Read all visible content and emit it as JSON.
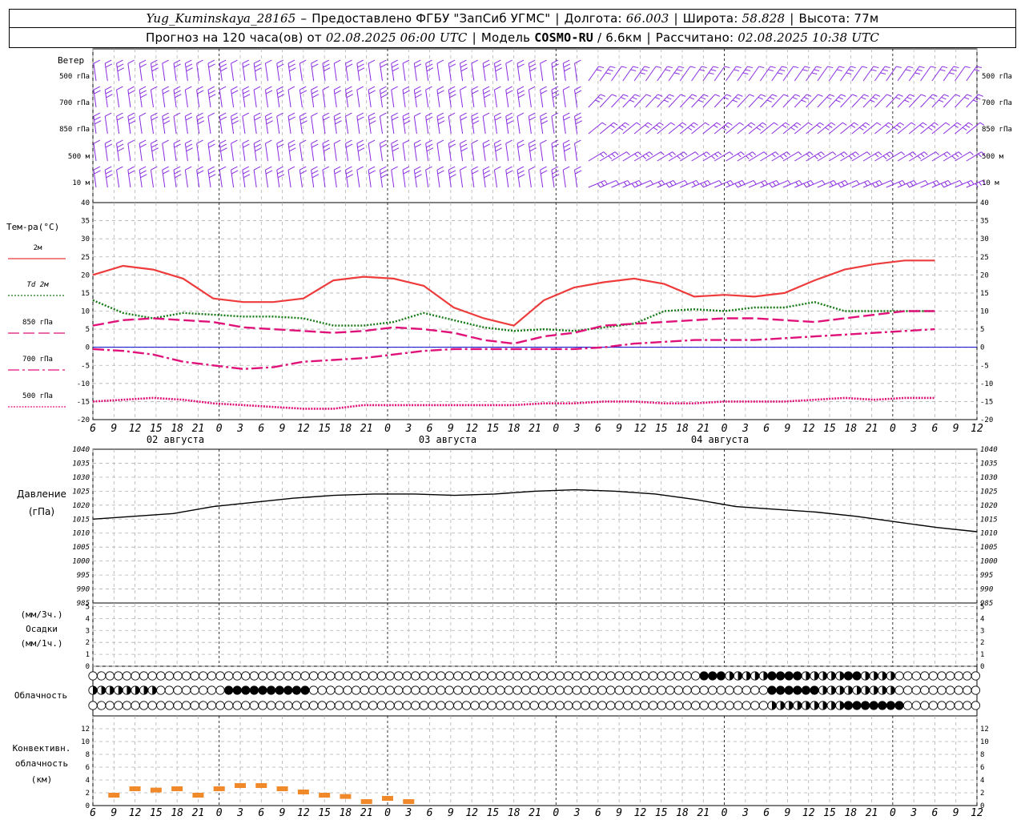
{
  "header": {
    "station": "Yug_Kuminskaya_28165",
    "dash": "–",
    "provider": "Предоставлено ФГБУ \"ЗапСиб УГМС\"",
    "lon_label": "Долгота:",
    "lon_value": "66.003",
    "lat_label": "Широта:",
    "lat_value": "58.828",
    "alt_label": "Высота:",
    "alt_value": "77м",
    "forecast_prefix": "Прогноз на 120 часа(ов) от",
    "forecast_start": "02.08.2025 06:00 UTC",
    "model_label": "Модель",
    "model_name": "COSMO-RU",
    "model_res": "/ 6.6км",
    "calc_label": "Рассчитано:",
    "calc_time": "02.08.2025 10:38 UTC"
  },
  "colors": {
    "t2m": "#ee3b3b",
    "td2m": "#157a15",
    "t850": "#e0127a",
    "t700": "#e0127a",
    "t500": "#e0127a",
    "wind": "#8a2be2",
    "pressure": "#000000",
    "convective": "#f0892a",
    "zero_line": "#0000cc",
    "grid": "#b0b0b0",
    "cloud_full": "#000000"
  },
  "wind_panel": {
    "title": "Ветер",
    "levels": [
      "500 гПа",
      "700 гПа",
      "850 гПа",
      "500 м",
      "10 м"
    ]
  },
  "temp_panel": {
    "title": "Тем-ра(°C)",
    "legend": [
      {
        "label": "2м",
        "style": "solid"
      },
      {
        "label": "Td 2м",
        "style": "dotted"
      },
      {
        "label": "850 гПа",
        "style": "dash"
      },
      {
        "label": "700 гПа",
        "style": "dashdot"
      },
      {
        "label": "500 гПа",
        "style": "dense-dot"
      }
    ]
  },
  "pressure_panel": {
    "title_1": "Давление",
    "title_2": "(гПа)"
  },
  "precip_panel": {
    "title_1": "(мм/3ч.)",
    "title_2": "Осадки",
    "title_3": "(мм/1ч.)"
  },
  "cloud_panel": {
    "title": "Облачность"
  },
  "conv_panel": {
    "title_1": "Конвективн.",
    "title_2": "облачность",
    "title_3": "(км)"
  },
  "date_labels": [
    "02 августа",
    "03 августа",
    "04 августа"
  ],
  "chart_data": [
    {
      "type": "line",
      "name": "temperature",
      "x_hours": [
        0,
        3,
        6,
        9,
        12,
        15,
        18,
        21,
        24,
        27,
        30,
        33,
        36,
        39,
        42,
        45,
        48,
        51,
        54,
        57,
        60,
        63,
        66,
        69,
        72,
        75,
        78,
        81,
        84,
        87,
        90,
        93,
        96,
        99,
        102,
        105,
        108,
        111,
        114,
        117,
        120
      ],
      "ylim": [
        -20,
        40
      ],
      "yticks": [
        -20,
        -15,
        -10,
        -5,
        0,
        5,
        10,
        15,
        20,
        25,
        30,
        35,
        40
      ],
      "xtick_labels": [
        "6",
        "9",
        "12",
        "15",
        "18",
        "21",
        "0",
        "3",
        "6",
        "9",
        "12",
        "15",
        "18",
        "21",
        "0",
        "3",
        "6",
        "9",
        "12",
        "15",
        "18",
        "21",
        "0",
        "3",
        "6",
        "9",
        "12",
        "15",
        "18",
        "21",
        "0",
        "3",
        "6",
        "9",
        "12",
        "15",
        "18",
        "21",
        "0",
        "3",
        "6",
        "9",
        "12"
      ],
      "series": [
        {
          "name": "2м",
          "values": [
            20,
            22.5,
            21.5,
            19,
            13.5,
            12.5,
            12.5,
            13.5,
            18.5,
            19.5,
            19,
            17,
            11,
            8,
            6,
            13,
            16.5,
            18,
            19,
            17.5,
            14,
            14.5,
            14,
            15,
            18.5,
            21.5,
            23,
            24,
            24
          ]
        },
        {
          "name": "Td 2м",
          "values": [
            13,
            9.5,
            8,
            9.5,
            9,
            8.5,
            8.5,
            8,
            6,
            6,
            7,
            9.5,
            7.5,
            5.5,
            4.5,
            5,
            4.5,
            5.5,
            6.5,
            10,
            10.5,
            10,
            11,
            11,
            12.5,
            10,
            10,
            10,
            10
          ]
        },
        {
          "name": "850 гПа",
          "values": [
            6,
            7.5,
            8,
            7.5,
            7,
            5.5,
            5,
            4.5,
            4,
            4.5,
            5.5,
            5,
            4,
            2,
            1,
            3,
            4,
            6,
            6.5,
            7,
            7.5,
            8,
            8,
            7.5,
            7,
            8,
            9,
            10,
            10
          ]
        },
        {
          "name": "700 гПа",
          "values": [
            -0.5,
            -1,
            -2,
            -4,
            -5,
            -6,
            -5.5,
            -4,
            -3.5,
            -3,
            -2,
            -1,
            -0.5,
            -0.5,
            -0.5,
            -0.5,
            -0.5,
            0,
            1,
            1.5,
            2,
            2,
            2,
            2.5,
            3,
            3.5,
            4,
            4.5,
            5
          ]
        },
        {
          "name": "500 гПа",
          "values": [
            -15,
            -14.5,
            -14,
            -14.5,
            -15.5,
            -16,
            -16.5,
            -17,
            -17,
            -16,
            -16,
            -16,
            -16,
            -16,
            -16,
            -15.5,
            -15.5,
            -15,
            -15,
            -15.5,
            -15.5,
            -15,
            -15,
            -15,
            -14.5,
            -14,
            -14.5,
            -14,
            -14
          ]
        }
      ]
    },
    {
      "type": "line",
      "name": "pressure",
      "ylim": [
        985,
        1040
      ],
      "yticks": [
        985,
        990,
        995,
        1000,
        1005,
        1010,
        1015,
        1020,
        1025,
        1030,
        1035,
        1040
      ],
      "series": [
        {
          "name": "Давление",
          "values": [
            1015,
            1016,
            1017,
            1019.5,
            1021,
            1022.5,
            1023.5,
            1024,
            1024,
            1023.5,
            1024,
            1025,
            1025.5,
            1025,
            1024,
            1022,
            1019.5,
            1018.5,
            1017.5,
            1016,
            1014,
            1012,
            1010.5
          ]
        }
      ]
    },
    {
      "type": "bar",
      "name": "precipitation",
      "ylim": [
        0,
        5
      ],
      "yticks": [
        0,
        1,
        2,
        3,
        4,
        5
      ],
      "values": []
    },
    {
      "type": "bar",
      "name": "convective_cloud",
      "ylim": [
        0,
        14
      ],
      "yticks": [
        0,
        2,
        4,
        6,
        8,
        10,
        12
      ],
      "series": [
        {
          "name": "Конвективная облачность",
          "values": [
            2,
            3,
            2.8,
            3,
            2,
            3,
            3.5,
            3.5,
            3,
            2.5,
            2,
            1.8,
            1,
            1.5,
            1
          ]
        }
      ]
    }
  ]
}
